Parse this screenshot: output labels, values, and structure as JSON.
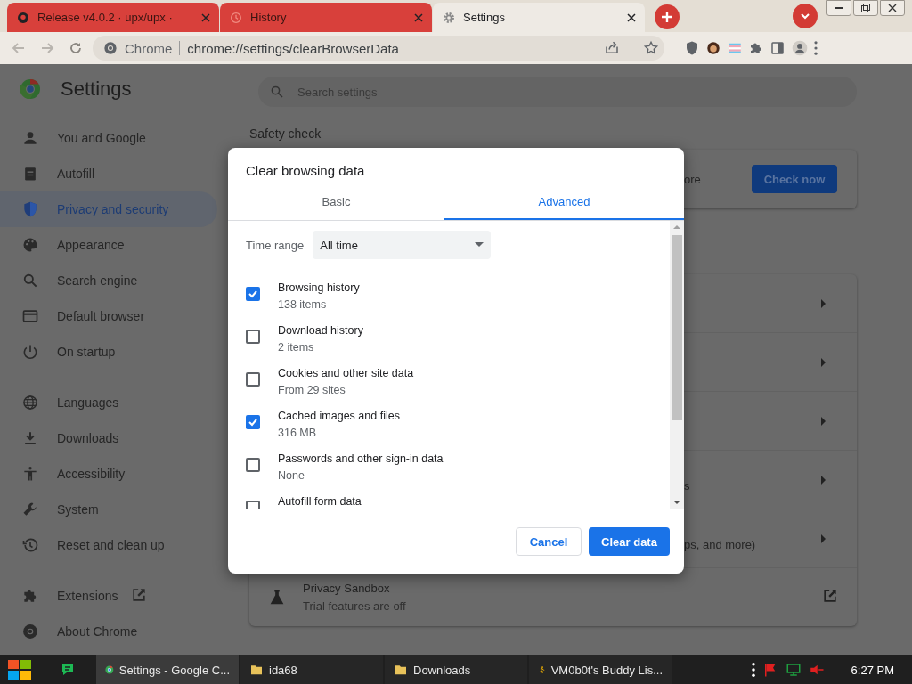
{
  "browser_tabs": [
    {
      "title": "Release v4.0.2 · upx/upx ·",
      "selected": false
    },
    {
      "title": "History",
      "selected": false
    },
    {
      "title": "Settings",
      "selected": true
    }
  ],
  "toolbar": {
    "site_chip": "Chrome",
    "url": "chrome://settings/clearBrowserData"
  },
  "settings": {
    "title": "Settings",
    "search_placeholder": "Search settings",
    "sidebar": [
      {
        "label": "You and Google",
        "selected": false
      },
      {
        "label": "Autofill",
        "selected": false
      },
      {
        "label": "Privacy and security",
        "selected": true
      },
      {
        "label": "Appearance",
        "selected": false
      },
      {
        "label": "Search engine",
        "selected": false
      },
      {
        "label": "Default browser",
        "selected": false
      },
      {
        "label": "On startup",
        "selected": false
      },
      {
        "label": "Languages",
        "selected": false
      },
      {
        "label": "Downloads",
        "selected": false
      },
      {
        "label": "Accessibility",
        "selected": false
      },
      {
        "label": "System",
        "selected": false
      },
      {
        "label": "Reset and clean up",
        "selected": false
      },
      {
        "label": "Extensions",
        "selected": false
      },
      {
        "label": "About Chrome",
        "selected": false
      }
    ],
    "safety_check": {
      "heading": "Safety check",
      "text_fragment": "ore",
      "button": "Check now"
    },
    "privacy_rows": [
      {
        "text_fragment": ""
      },
      {
        "text_fragment": ""
      },
      {
        "text_fragment": ""
      },
      {
        "text_fragment": "s"
      },
      {
        "text_fragment": "ps, and more)"
      }
    ],
    "privacy_sandbox": {
      "title": "Privacy Sandbox",
      "subtitle": "Trial features are off"
    }
  },
  "dialog": {
    "title": "Clear browsing data",
    "tabs": [
      {
        "label": "Basic",
        "selected": false
      },
      {
        "label": "Advanced",
        "selected": true
      }
    ],
    "time_range": {
      "label": "Time range",
      "value": "All time"
    },
    "items": [
      {
        "title": "Browsing history",
        "detail": "138 items",
        "checked": true
      },
      {
        "title": "Download history",
        "detail": "2 items",
        "checked": false
      },
      {
        "title": "Cookies and other site data",
        "detail": "From 29 sites",
        "checked": false
      },
      {
        "title": "Cached images and files",
        "detail": "316 MB",
        "checked": true
      },
      {
        "title": "Passwords and other sign-in data",
        "detail": "None",
        "checked": false
      },
      {
        "title": "Autofill form data",
        "checked": false
      }
    ],
    "buttons": [
      "Cancel",
      "Clear data"
    ]
  },
  "taskbar": {
    "items": [
      {
        "label": "Settings - Google C...",
        "selected": true
      },
      {
        "label": "ida68",
        "selected": false
      },
      {
        "label": "Downloads",
        "selected": false
      },
      {
        "label": "VM0b0t's Buddy Lis...",
        "selected": false
      }
    ],
    "clock": "6:27 PM"
  }
}
